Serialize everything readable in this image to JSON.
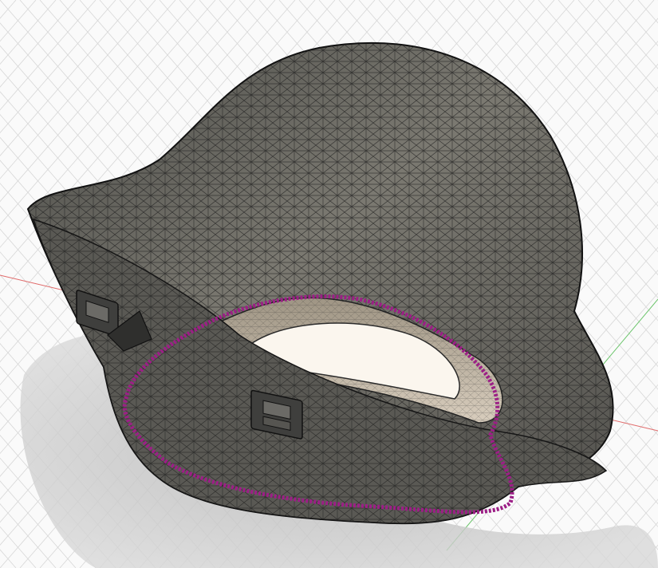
{
  "viewport": {
    "background": "#fafafa",
    "grid_color": "#d7d7d7",
    "axis_x_color": "#e06a6a",
    "axis_y_color": "#6ac46a",
    "shadow_color": "#bdbdbd"
  },
  "model": {
    "body_color": "#5f5e59",
    "body_highlight": "#8f8c84",
    "inner_color": "#b8ad9a",
    "opening_color": "#fbf6ee",
    "edge_color": "#151515",
    "selection_color": "#9c1f86"
  },
  "icons": {
    "clip_top": "clip-slot-icon",
    "clip_bottom": "clip-slot-icon"
  }
}
